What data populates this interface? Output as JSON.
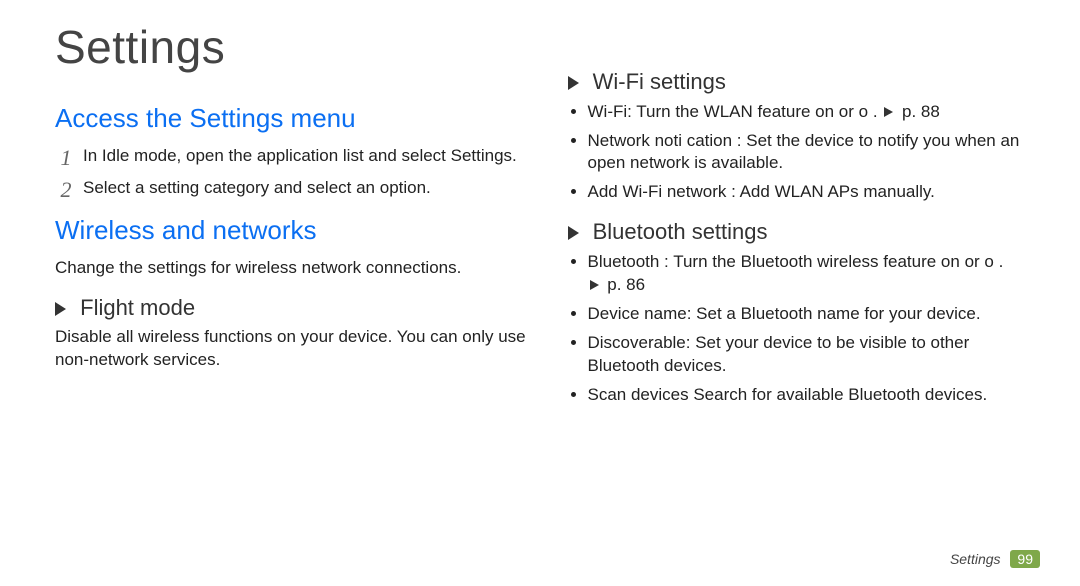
{
  "title": "Settings",
  "left": {
    "access_heading": "Access the Settings menu",
    "steps": [
      {
        "num": "1",
        "text": "In Idle mode, open the application list and select Settings."
      },
      {
        "num": "2",
        "text": "Select a setting category and select an option."
      }
    ],
    "wireless_heading": "Wireless and networks",
    "wireless_desc": "Change the settings for wireless network connections.",
    "flight_heading": "Flight mode",
    "flight_desc": "Disable all wireless functions on your device. You can only use non-network services."
  },
  "right": {
    "wifi_heading": "Wi-Fi settings",
    "wifi_items": {
      "i0_prefix": "Wi-Fi: Turn the WLAN feature on or o .",
      "i0_suffix": "p. 88",
      "i1": "Network noti cation : Set the device to notify you when an open network is available.",
      "i2": "Add Wi-Fi network : Add WLAN APs manually."
    },
    "bt_heading": "Bluetooth settings",
    "bt_items": {
      "i0": "Bluetooth : Turn the Bluetooth wireless feature on or o .",
      "i0b": "p. 86",
      "i1": "Device name: Set a Bluetooth name for your device.",
      "i2": "Discoverable: Set your device to be visible to other Bluetooth devices.",
      "i3": "Scan devices Search for available Bluetooth devices."
    }
  },
  "footer": {
    "label": "Settings",
    "page": "99"
  }
}
